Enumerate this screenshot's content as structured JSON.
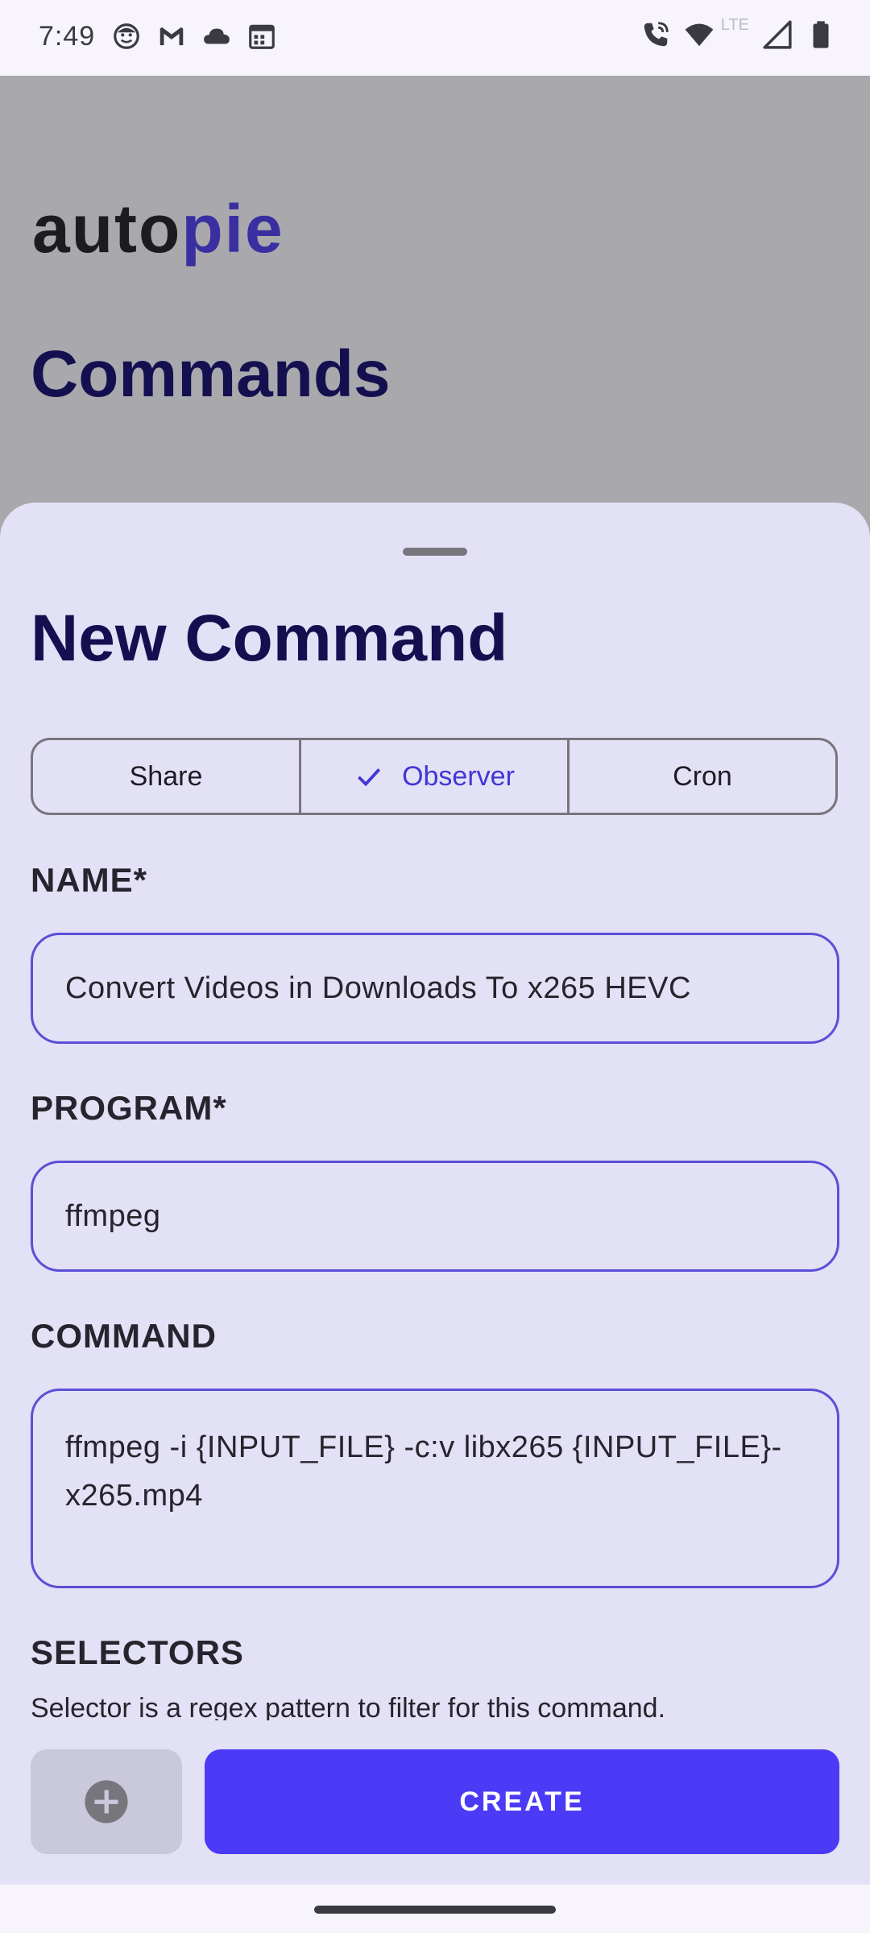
{
  "status_bar": {
    "time": "7:49",
    "network_label": "LTE",
    "icons_left": [
      "face-icon",
      "gmail-icon",
      "cloud-icon",
      "calendar-icon"
    ],
    "icons_right": [
      "wifi-calling-icon",
      "wifi-icon",
      "signal-icon",
      "battery-icon"
    ]
  },
  "background": {
    "brand_part1": "auto",
    "brand_part2": "pie",
    "heading": "Commands"
  },
  "sheet": {
    "title": "New Command",
    "segments": [
      {
        "label": "Share",
        "selected": false
      },
      {
        "label": "Observer",
        "selected": true
      },
      {
        "label": "Cron",
        "selected": false
      }
    ],
    "name_label": "NAME*",
    "name_value": "Convert Videos in Downloads To x265 HEVC",
    "program_label": "PROGRAM*",
    "program_value": "ffmpeg",
    "command_label": "COMMAND",
    "command_value": "ffmpeg -i {INPUT_FILE} -c:v libx265 {INPUT_FILE}-x265.mp4",
    "selectors_label": "SELECTORS",
    "selectors_desc": "Selector is a regex pattern to filter for this command.",
    "create_label": "CREATE"
  },
  "colors": {
    "accent": "#4b3af6",
    "sheet_bg": "#e3e1f6",
    "title": "#141050"
  }
}
